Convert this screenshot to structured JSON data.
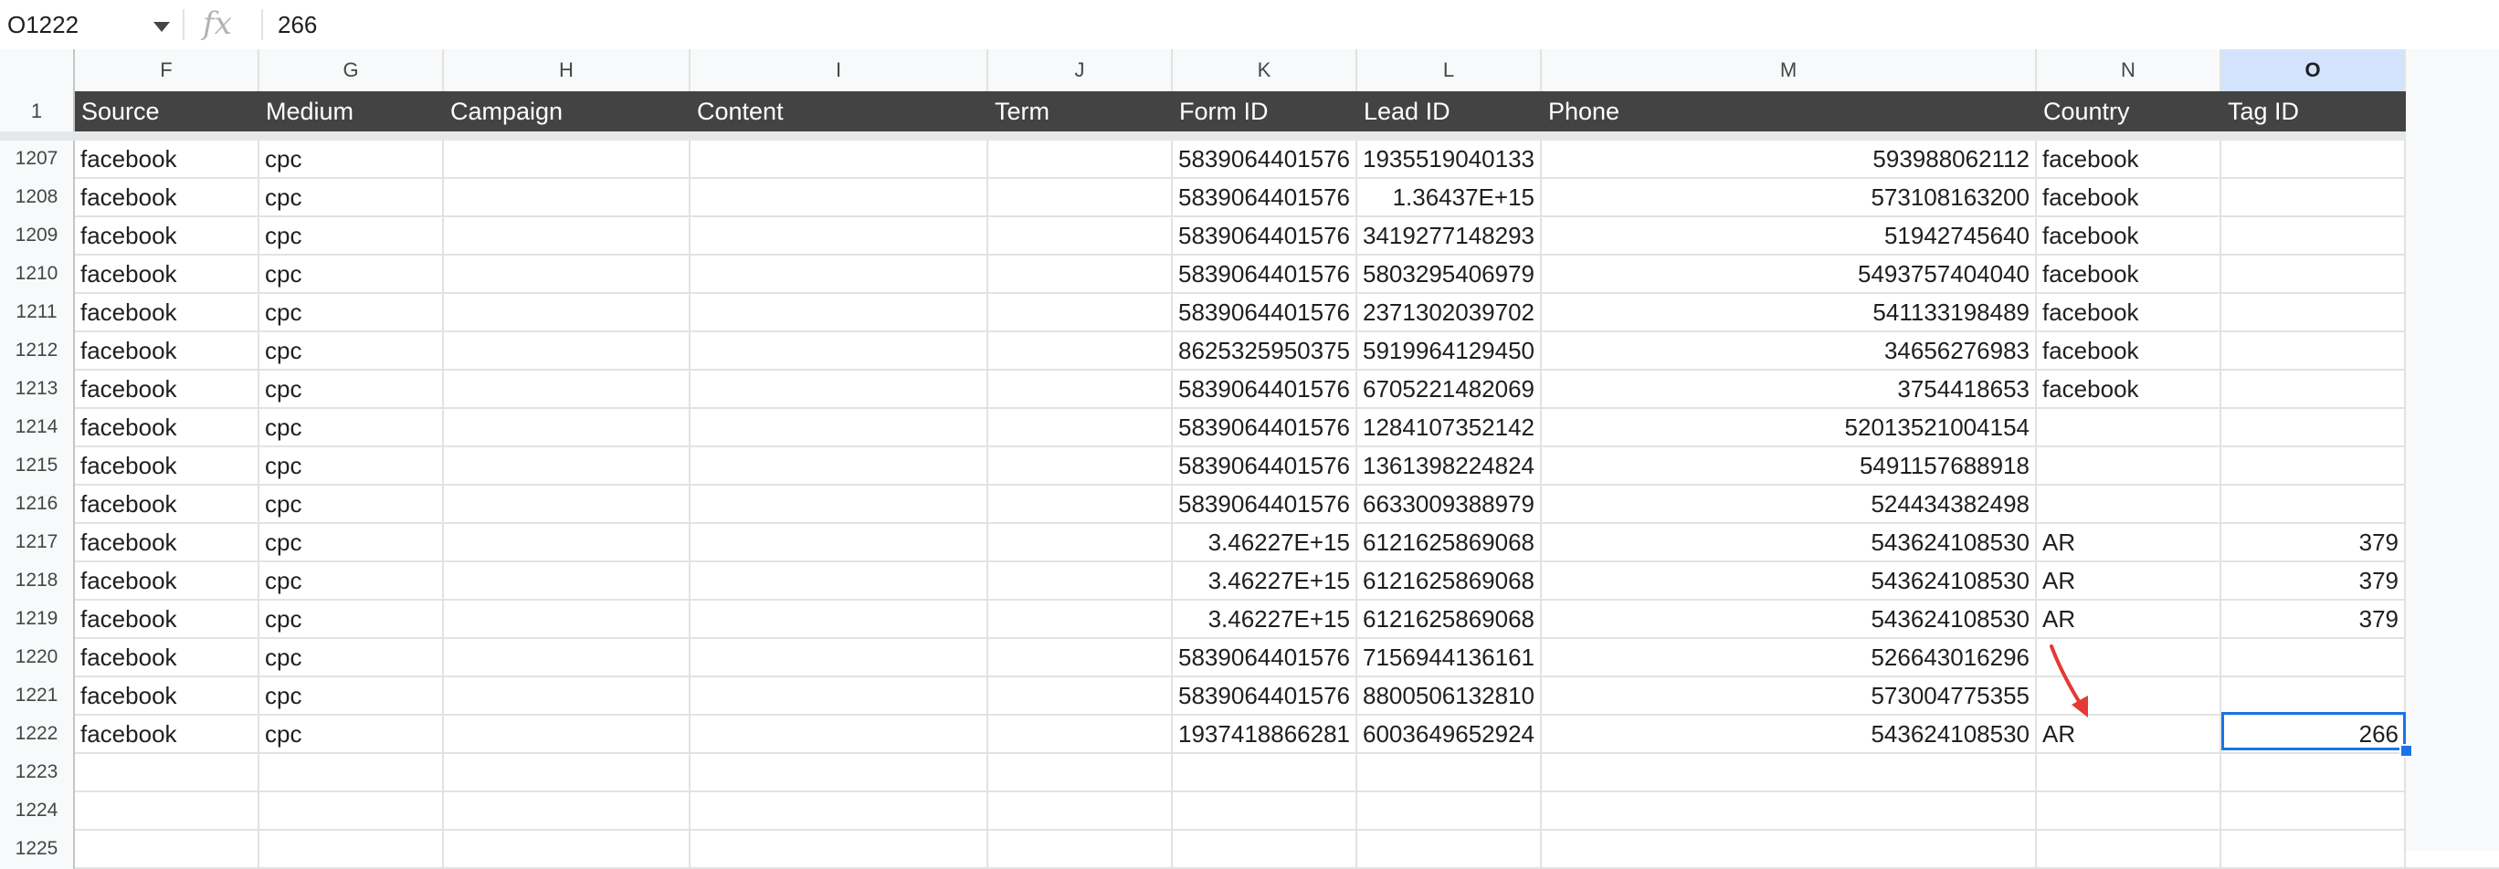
{
  "formula_bar": {
    "name_box": "O1222",
    "fx_label": "fx",
    "value": "266"
  },
  "columns": [
    "F",
    "G",
    "H",
    "I",
    "J",
    "K",
    "L",
    "M",
    "N",
    "O"
  ],
  "selected_column": "O",
  "header_row": {
    "row_number": "1",
    "cells": [
      "Source",
      "Medium",
      "Campaign",
      "Content",
      "Term",
      "Form ID",
      "Lead ID",
      "Phone",
      "Country",
      "Tag ID"
    ]
  },
  "rows": [
    {
      "n": "1207",
      "source": "facebook",
      "medium": "cpc",
      "form_id": "5839064401576",
      "lead_id": "1935519040133",
      "phone": "593988062112",
      "country": "facebook",
      "tag_id": ""
    },
    {
      "n": "1208",
      "source": "facebook",
      "medium": "cpc",
      "form_id": "5839064401576",
      "lead_id": "1.36437E+15",
      "phone": "573108163200",
      "country": "facebook",
      "tag_id": ""
    },
    {
      "n": "1209",
      "source": "facebook",
      "medium": "cpc",
      "form_id": "5839064401576",
      "lead_id": "3419277148293",
      "phone": "51942745640",
      "country": "facebook",
      "tag_id": ""
    },
    {
      "n": "1210",
      "source": "facebook",
      "medium": "cpc",
      "form_id": "5839064401576",
      "lead_id": "5803295406979",
      "phone": "5493757404040",
      "country": "facebook",
      "tag_id": ""
    },
    {
      "n": "1211",
      "source": "facebook",
      "medium": "cpc",
      "form_id": "5839064401576",
      "lead_id": "2371302039702",
      "phone": "541133198489",
      "country": "facebook",
      "tag_id": ""
    },
    {
      "n": "1212",
      "source": "facebook",
      "medium": "cpc",
      "form_id": "8625325950375",
      "lead_id": "5919964129450",
      "phone": "34656276983",
      "country": "facebook",
      "tag_id": ""
    },
    {
      "n": "1213",
      "source": "facebook",
      "medium": "cpc",
      "form_id": "5839064401576",
      "lead_id": "6705221482069",
      "phone": "3754418653",
      "country": "facebook",
      "tag_id": ""
    },
    {
      "n": "1214",
      "source": "facebook",
      "medium": "cpc",
      "form_id": "5839064401576",
      "lead_id": "1284107352142",
      "phone": "52013521004154",
      "country": "",
      "tag_id": ""
    },
    {
      "n": "1215",
      "source": "facebook",
      "medium": "cpc",
      "form_id": "5839064401576",
      "lead_id": "1361398224824",
      "phone": "5491157688918",
      "country": "",
      "tag_id": ""
    },
    {
      "n": "1216",
      "source": "facebook",
      "medium": "cpc",
      "form_id": "5839064401576",
      "lead_id": "6633009388979",
      "phone": "524434382498",
      "country": "",
      "tag_id": ""
    },
    {
      "n": "1217",
      "source": "facebook",
      "medium": "cpc",
      "form_id": "3.46227E+15",
      "lead_id": "6121625869068",
      "phone": "543624108530",
      "country": "AR",
      "tag_id": "379"
    },
    {
      "n": "1218",
      "source": "facebook",
      "medium": "cpc",
      "form_id": "3.46227E+15",
      "lead_id": "6121625869068",
      "phone": "543624108530",
      "country": "AR",
      "tag_id": "379"
    },
    {
      "n": "1219",
      "source": "facebook",
      "medium": "cpc",
      "form_id": "3.46227E+15",
      "lead_id": "6121625869068",
      "phone": "543624108530",
      "country": "AR",
      "tag_id": "379"
    },
    {
      "n": "1220",
      "source": "facebook",
      "medium": "cpc",
      "form_id": "5839064401576",
      "lead_id": "7156944136161",
      "phone": "526643016296",
      "country": "",
      "tag_id": ""
    },
    {
      "n": "1221",
      "source": "facebook",
      "medium": "cpc",
      "form_id": "5839064401576",
      "lead_id": "8800506132810",
      "phone": "573004775355",
      "country": "",
      "tag_id": ""
    },
    {
      "n": "1222",
      "source": "facebook",
      "medium": "cpc",
      "form_id": "1937418866281",
      "lead_id": "6003649652924",
      "phone": "543624108530",
      "country": "AR",
      "tag_id": "266"
    },
    {
      "n": "1223",
      "source": "",
      "medium": "",
      "form_id": "",
      "lead_id": "",
      "phone": "",
      "country": "",
      "tag_id": ""
    },
    {
      "n": "1224",
      "source": "",
      "medium": "",
      "form_id": "",
      "lead_id": "",
      "phone": "",
      "country": "",
      "tag_id": ""
    },
    {
      "n": "1225",
      "source": "",
      "medium": "",
      "form_id": "",
      "lead_id": "",
      "phone": "",
      "country": "",
      "tag_id": ""
    }
  ],
  "colors": {
    "header_bg": "#434343",
    "selection": "#1a73e8",
    "annotation_arrow": "#e53935"
  }
}
